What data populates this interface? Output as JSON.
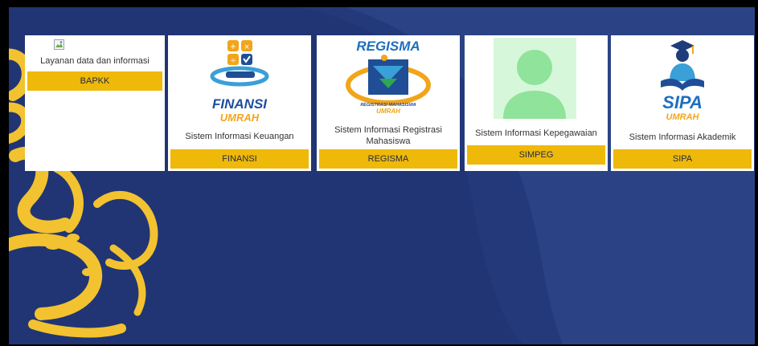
{
  "cards": [
    {
      "description": "Layanan data dan informasi",
      "button_label": "BAPKK"
    },
    {
      "logo_text_top": "FINANSI",
      "logo_text_bottom": "UMRAH",
      "description": "Sistem Informasi Keuangan",
      "button_label": "FINANSI"
    },
    {
      "logo_text_top": "REGISMA",
      "logo_text_sub": "REGISTRASI MAHASISWA",
      "logo_text_bottom": "UMRAH",
      "description": "Sistem Informasi Registrasi Mahasiswa",
      "button_label": "REGISMA"
    },
    {
      "description": "Sistem Informasi Kepegawaian",
      "button_label": "SIMPEG"
    },
    {
      "logo_text_top": "SIPA",
      "logo_text_bottom": "UMRAH",
      "description": "Sistem Informasi Akademik",
      "button_label": "SIPA"
    }
  ],
  "colors": {
    "background": "#24397a",
    "accent": "#efb90a",
    "card": "#ffffff",
    "calligraphy": "#f2c230"
  },
  "icons": {
    "card_1": "broken-image-icon",
    "card_2": "finansi-logo",
    "card_3": "regisma-logo",
    "card_4": "user-avatar-icon",
    "card_5": "sipa-logo"
  }
}
